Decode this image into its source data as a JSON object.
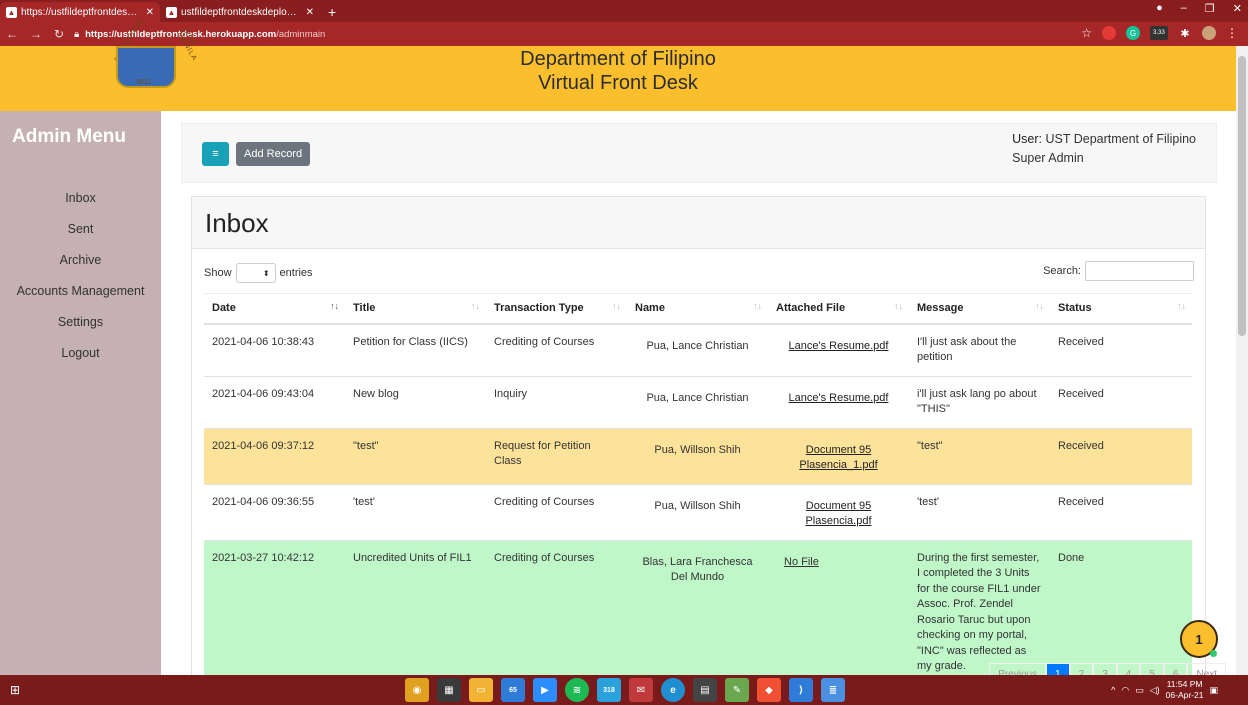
{
  "browser": {
    "tabs": [
      {
        "label": "https://ustfildeptfrontdesk.heroku",
        "active": true
      },
      {
        "label": "ustfildeptfrontdeskdeployed.test",
        "active": false
      }
    ],
    "url_host": "https://ustfildeptfrontdesk.herokuapp.com",
    "url_path": "/adminmain",
    "ext_badge": "3.33"
  },
  "header": {
    "title_line1": "Department of Filipino",
    "title_line2": "Virtual Front Desk",
    "seal_year": "1611"
  },
  "sidebar": {
    "title": "Admin Menu",
    "items": [
      "Inbox",
      "Sent",
      "Archive",
      "Accounts Management",
      "Settings",
      "Logout"
    ]
  },
  "toolbar": {
    "toggle_label": "≡",
    "add_label": "Add Record",
    "user_label": "User:",
    "user_name": "UST Department of Filipino",
    "role": "Super Admin"
  },
  "inbox": {
    "title": "Inbox",
    "show_label": "Show",
    "entries_label": "entries",
    "search_label": "Search:",
    "columns": [
      "Date",
      "Title",
      "Transaction Type",
      "Name",
      "Attached File",
      "Message",
      "Status"
    ],
    "rows": [
      {
        "date": "2021-04-06 10:38:43",
        "title": "Petition for Class (IICS)",
        "type": "Crediting of Courses",
        "name": "Pua, Lance Christian",
        "file": "Lance's Resume.pdf",
        "message": "I'll just ask about the petition",
        "status": "Received",
        "style": "white"
      },
      {
        "date": "2021-04-06 09:43:04",
        "title": "New blog",
        "type": "Inquiry",
        "name": "Pua, Lance Christian",
        "file": "Lance's Resume.pdf",
        "message": "i'll just ask lang po about \"THIS\"",
        "status": "Received",
        "style": "white"
      },
      {
        "date": "2021-04-06 09:37:12",
        "title": "\"test\"",
        "type": "Request for Petition Class",
        "name": "Pua, Willson Shih",
        "file": "Document 95 Plasencia_1.pdf",
        "message": "\"test\"",
        "status": "Received",
        "style": "yellow"
      },
      {
        "date": "2021-04-06 09:36:55",
        "title": "'test'",
        "type": "Crediting of Courses",
        "name": "Pua, Willson Shih",
        "file": "Document 95 Plasencia.pdf",
        "message": "'test'",
        "status": "Received",
        "style": "white"
      },
      {
        "date": "2021-03-27 10:42:12",
        "title": "Uncredited Units of FIL1",
        "type": "Crediting of Courses",
        "name": "Blas, Lara Franchesca Del Mundo",
        "file": "No File",
        "message": "During the first semester, I completed the 3 Units for the course FIL1 under Assoc. Prof. Zendel Rosario Taruc but upon checking on my portal, \"INC\" was reflected as my grade.",
        "status": "Done",
        "style": "green"
      }
    ],
    "pager": [
      "Previous",
      "1",
      "2",
      "3",
      "4",
      "5",
      "6",
      "Next"
    ]
  },
  "chat": {
    "count": "1"
  },
  "taskbar": {
    "time": "11:54 PM",
    "date": "06-Apr-21",
    "badge1": "65",
    "badge2": "318"
  }
}
